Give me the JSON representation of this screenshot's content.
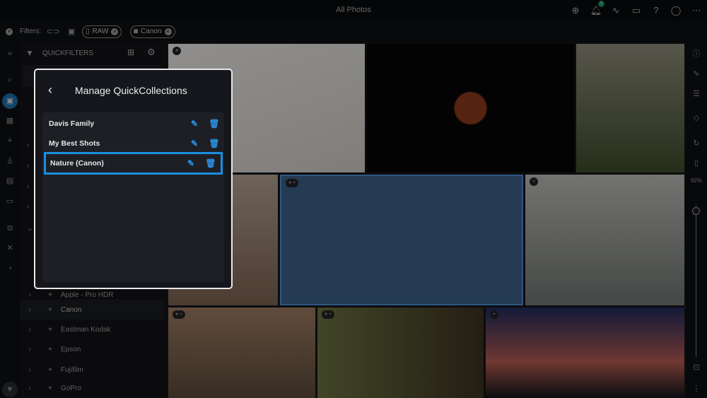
{
  "header": {
    "title": "All Photos",
    "notification_count": "1"
  },
  "filters": {
    "label": "Filters:",
    "chips": [
      {
        "label": "RAW"
      },
      {
        "label": "Canon"
      }
    ]
  },
  "quickfilters": {
    "title": "QUICKFILTERS"
  },
  "tree": [
    {
      "label": "Apple - Pro HDR"
    },
    {
      "label": "Canon"
    },
    {
      "label": "Eastman Kodak"
    },
    {
      "label": "Epson"
    },
    {
      "label": "Fujifilm"
    },
    {
      "label": "GoPro"
    }
  ],
  "right_toolbar": {
    "zoom": "92%"
  },
  "modal": {
    "title": "Manage QuickCollections",
    "items": [
      {
        "label": "Davis Family"
      },
      {
        "label": "My Best Shots"
      },
      {
        "label": "Nature (Canon)",
        "selected": true
      }
    ]
  },
  "colors": {
    "accent": "#1a8fe0"
  }
}
